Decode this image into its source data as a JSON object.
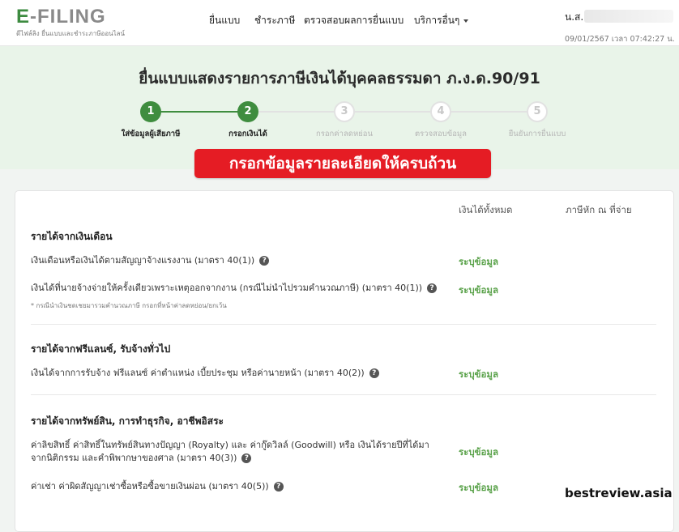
{
  "brand": {
    "logo_text": "E-FILING",
    "tagline": "ดีไฟล์ลิง ยื่นแบบและชำระภาษีออนไลน์",
    "accent": "#3f8d3f"
  },
  "nav": {
    "items": [
      "ยื่นแบบ",
      "ชำระภาษี",
      "ตรวจสอบผลการยื่นแบบ",
      "บริการอื่นๆ"
    ]
  },
  "user": {
    "name": "น.ส.",
    "datetime": "09/01/2567 เวลา 07:42:27 น."
  },
  "form": {
    "title": "ยื่นแบบแสดงรายการภาษีเงินได้บุคคลธรรมดา ภ.ง.ด.90/91"
  },
  "steps": [
    {
      "number": "1",
      "label": "ใส่ข้อมูลผู้เสียภาษี",
      "state": "done"
    },
    {
      "number": "2",
      "label": "กรอกเงินได้",
      "state": "done"
    },
    {
      "number": "3",
      "label": "กรอกค่าลดหย่อน",
      "state": "todo"
    },
    {
      "number": "4",
      "label": "ตรวจสอบข้อมูล",
      "state": "todo"
    },
    {
      "number": "5",
      "label": "ยืนยันการยื่นแบบ",
      "state": "todo"
    }
  ],
  "banner": {
    "text": "กรอกข้อมูลรายละเอียดให้ครบถ้วน",
    "color": "#e51c24"
  },
  "table": {
    "col_total": "เงินได้ทั้งหมด",
    "col_withheld": "ภาษีหัก ณ ที่จ่าย"
  },
  "sections": [
    {
      "title": "รายได้จากเงินเดือน",
      "rows": [
        {
          "text": "เงินเดือนหรือเงินได้ตามสัญญาจ้างแรงงาน (มาตรา 40(1))",
          "action": "ระบุข้อมูล"
        },
        {
          "text": "เงินได้ที่นายจ้างจ่ายให้ครั้งเดียวเพราะเหตุออกจากงาน (กรณีไม่นำไปรวมคำนวณภาษี) (มาตรา 40(1))",
          "note": "* กรณีนำเงินชดเชยมารวมคำนวณภาษี กรอกที่หน้าค่าลดหย่อน/ยกเว้น",
          "action": "ระบุข้อมูล"
        }
      ]
    },
    {
      "title": "รายได้จากฟรีแลนซ์, รับจ้างทั่วไป",
      "rows": [
        {
          "text": "เงินได้จากการรับจ้าง ฟรีแลนซ์ ค่าตำแหน่ง เบี้ยประชุม หรือค่านายหน้า (มาตรา 40(2))",
          "action": "ระบุข้อมูล"
        }
      ]
    },
    {
      "title": "รายได้จากทรัพย์สิน, การทำธุรกิจ, อาชีพอิสระ",
      "rows": [
        {
          "text_line1": "ค่าลิขสิทธิ์ ค่าสิทธิ์ในทรัพย์สินทางปัญญา (Royalty) และ ค่ากู๊ดวิลล์ (Goodwill) หรือ เงินได้รายปีที่ได้มา",
          "text_line2": "จากนิติกรรม และคำพิพากษาของศาล (มาตรา 40(3))",
          "action": "ระบุข้อมูล"
        },
        {
          "text": "ค่าเช่า ค่าผิดสัญญาเช่าซื้อหรือซื้อขายเงินผ่อน (มาตรา 40(5))",
          "action": "ระบุข้อมูล"
        }
      ]
    }
  ],
  "watermark": "bestreview.asia"
}
